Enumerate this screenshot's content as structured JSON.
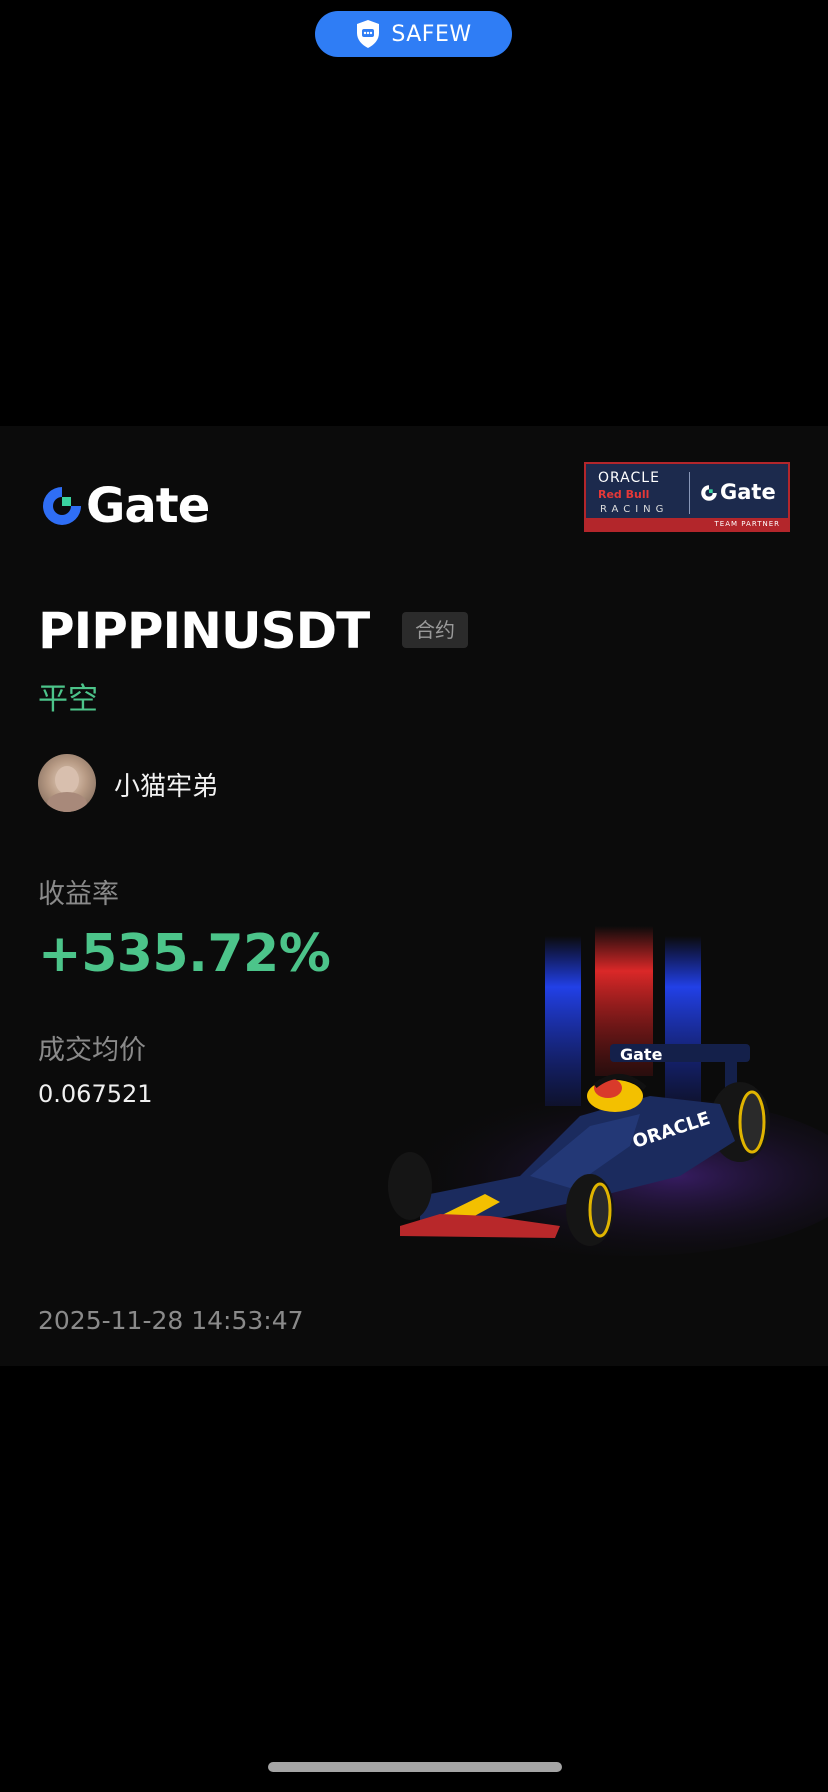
{
  "top_pill": {
    "icon": "shield-chat-icon",
    "label": "SAFEW",
    "color": "#2f7df5"
  },
  "card": {
    "brand": "Gate",
    "partner_badge": {
      "line1": "ORACLE",
      "line2": "Red Bull",
      "line3": "RACING",
      "brand": "Gate",
      "strip": "TEAM PARTNER"
    },
    "symbol": "PIPPINUSDT",
    "contract_tag": "合约",
    "side": "平空",
    "username": "小猫牢弟",
    "roi_label": "收益率",
    "roi_value": "+535.72%",
    "avg_price_label": "成交均价",
    "avg_price_value": "0.067521",
    "timestamp": "2025-11-28 14:53:47",
    "accent_color": "#4cc48a"
  }
}
